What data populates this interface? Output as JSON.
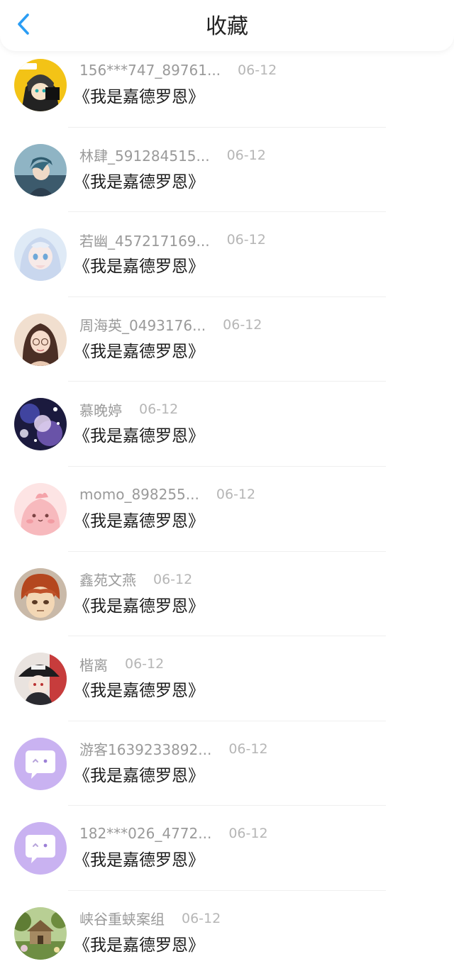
{
  "header": {
    "title": "收藏",
    "back_icon": "chevron-left-icon",
    "accent_color": "#2a9df4"
  },
  "items": [
    {
      "user": "156***747_89761...",
      "date": "06-12",
      "title": "《我是嘉德罗恩》",
      "avatar": "avatar-anime-yellow"
    },
    {
      "user": "林肆_591284515...",
      "date": "06-12",
      "title": "《我是嘉德罗恩》",
      "avatar": "avatar-anime-boy-blue"
    },
    {
      "user": "若幽_457217169...",
      "date": "06-12",
      "title": "《我是嘉德罗恩》",
      "avatar": "avatar-anime-girl-white"
    },
    {
      "user": "周海英_0493176...",
      "date": "06-12",
      "title": "《我是嘉德罗恩》",
      "avatar": "avatar-girl-glasses"
    },
    {
      "user": "慕晚婷",
      "date": "06-12",
      "title": "《我是嘉德罗恩》",
      "avatar": "avatar-galaxy"
    },
    {
      "user": "momo_898255...",
      "date": "06-12",
      "title": "《我是嘉德罗恩》",
      "avatar": "avatar-pink-blob"
    },
    {
      "user": "鑫苑文燕",
      "date": "06-12",
      "title": "《我是嘉德罗恩》",
      "avatar": "avatar-anime-boy-brown"
    },
    {
      "user": "楷离",
      "date": "06-12",
      "title": "《我是嘉德罗恩》",
      "avatar": "avatar-anime-hat"
    },
    {
      "user": "游客1639233892...",
      "date": "06-12",
      "title": "《我是嘉德罗恩》",
      "avatar": "avatar-default-chat"
    },
    {
      "user": "182***026_4772...",
      "date": "06-12",
      "title": "《我是嘉德罗恩》",
      "avatar": "avatar-default-chat"
    },
    {
      "user": "峡谷重蛱案组",
      "date": "06-12",
      "title": "《我是嘉德罗恩》",
      "avatar": "avatar-house-landscape"
    }
  ]
}
